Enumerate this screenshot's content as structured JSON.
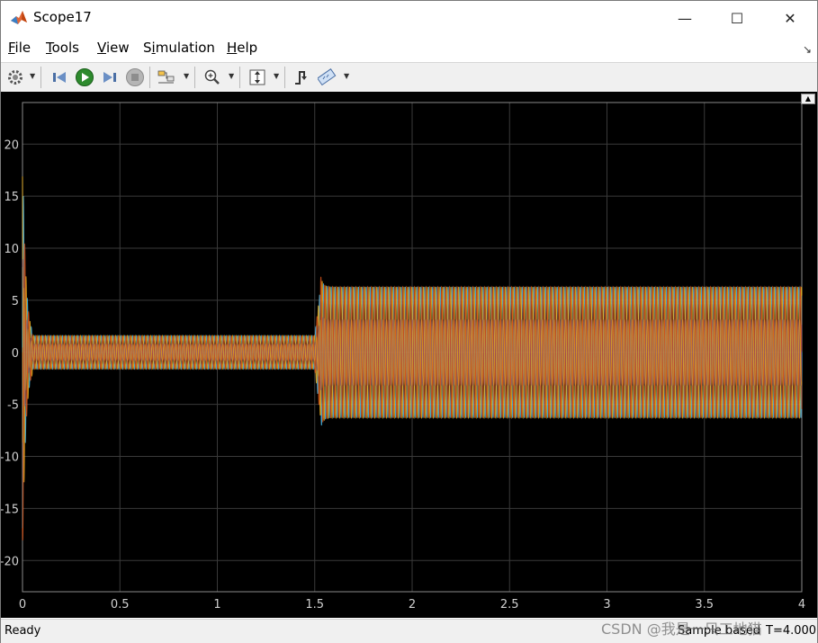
{
  "window": {
    "title": "Scope17"
  },
  "window_controls": {
    "minimize": "—",
    "maximize": "☐",
    "close": "✕"
  },
  "menu": [
    {
      "label": "File",
      "key": "F",
      "rest": "ile"
    },
    {
      "label": "Tools",
      "key": "T",
      "rest": "ools"
    },
    {
      "label": "View",
      "key": "V",
      "rest": "iew"
    },
    {
      "label": "Simulation",
      "key": "i",
      "pre": "S",
      "rest": "mulation"
    },
    {
      "label": "Help",
      "key": "H",
      "rest": "elp"
    }
  ],
  "toolbar": {
    "items": [
      "settings-icon",
      "step-back-icon",
      "run-icon",
      "step-forward-icon",
      "stop-icon",
      "highlight-block-icon",
      "zoom-in-icon",
      "autoscale-icon",
      "triggers-icon",
      "measure-icon"
    ]
  },
  "status": {
    "left": "Ready",
    "mode": "Sample based",
    "time": "T=4.000"
  },
  "watermark": "CSDN @我是一只工地猫",
  "colors": {
    "plot_bg": "#000000",
    "grid": "#3a3a3a",
    "axis_text": "#d0d0d0",
    "series": [
      "#0072BD",
      "#D95319",
      "#EDB120",
      "#7E2F8E",
      "#77AC30",
      "#4DBEEE",
      "#A2142F"
    ]
  },
  "chart_data": {
    "type": "line",
    "x_ticks": [
      "0",
      "0.5",
      "1",
      "1.5",
      "2",
      "2.5",
      "3",
      "3.5",
      "4"
    ],
    "y_ticks": [
      "20",
      "15",
      "10",
      "5",
      "0",
      "-5",
      "-10",
      "-15",
      "-20"
    ],
    "xlim": [
      0,
      4
    ],
    "ylim": [
      -23,
      24
    ],
    "grid": true,
    "series_count": 3,
    "segments": [
      {
        "t_start": 0.05,
        "t_end": 1.5,
        "amplitude": 1.6,
        "frequency_hz": 50
      },
      {
        "t_start": 1.53,
        "t_end": 4.0,
        "amplitude": 6.3,
        "frequency_hz": 50
      }
    ],
    "transients": [
      {
        "t": 0.0,
        "peak": 19.5,
        "trough": -18.7
      },
      {
        "t": 1.52,
        "peak": 7.4,
        "trough": -7.4
      }
    ]
  }
}
